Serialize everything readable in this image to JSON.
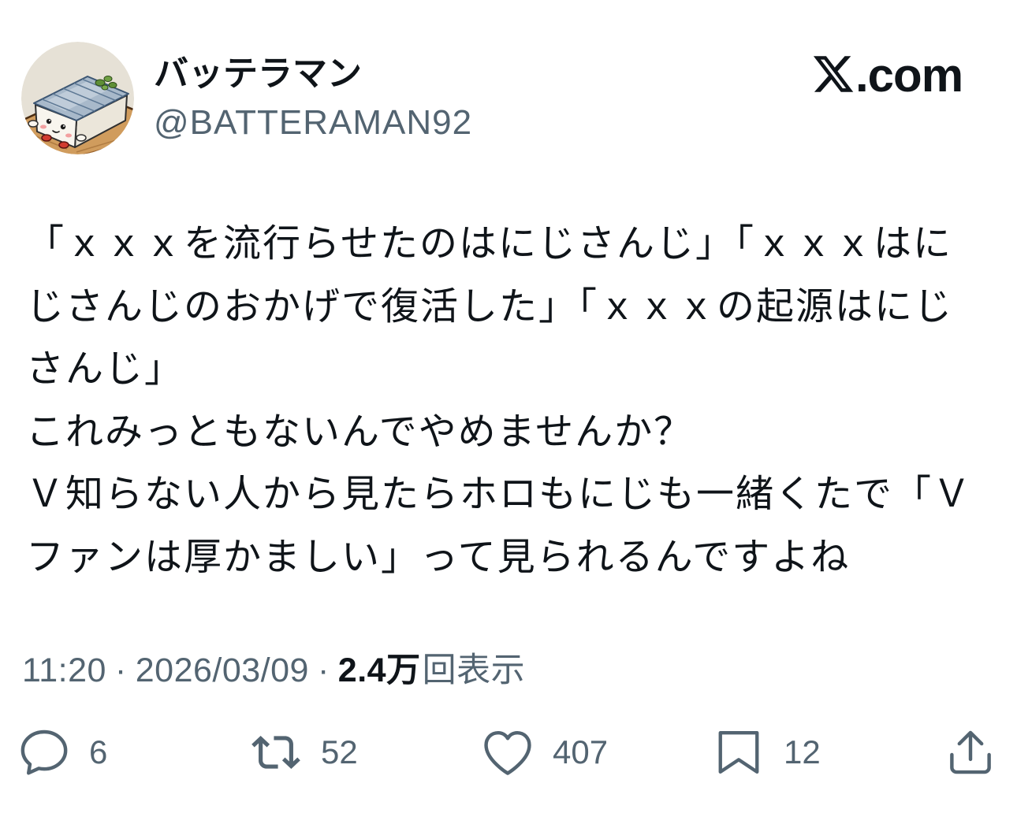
{
  "author": {
    "display_name": "バッテラマン",
    "handle": "@BATTERAMAN92",
    "avatar_icon": "battera-sushi-avatar-icon"
  },
  "brand": {
    "icon": "x-logo-icon",
    "suffix": ".com"
  },
  "tweet": {
    "lines": [
      "「ｘｘｘを流行らせたのはにじさんじ」「ｘｘｘはに",
      "じさんじのおかげで復活した」「ｘｘｘの起源はにじ",
      "さんじ」",
      "これみっともないんでやめませんか？",
      "Ｖ知らない人から見たらホロもにじも一緒くたで「Ｖ",
      "ファンは厚かましい」って見られるんですよね"
    ]
  },
  "meta": {
    "time": "11:20",
    "separator": "·",
    "date": "2026/03/09",
    "views_count": "2.4万",
    "views_label": "回表示"
  },
  "actions": [
    {
      "icon": "reply-icon",
      "count": "6"
    },
    {
      "icon": "repost-icon",
      "count": "52"
    },
    {
      "icon": "heart-icon",
      "count": "407"
    },
    {
      "icon": "bookmark-icon",
      "count": "12"
    },
    {
      "icon": "share-icon"
    }
  ],
  "colors": {
    "background": "#ffffff",
    "text_primary": "#0f1419",
    "text_secondary": "#536471",
    "icon": "#536471"
  }
}
